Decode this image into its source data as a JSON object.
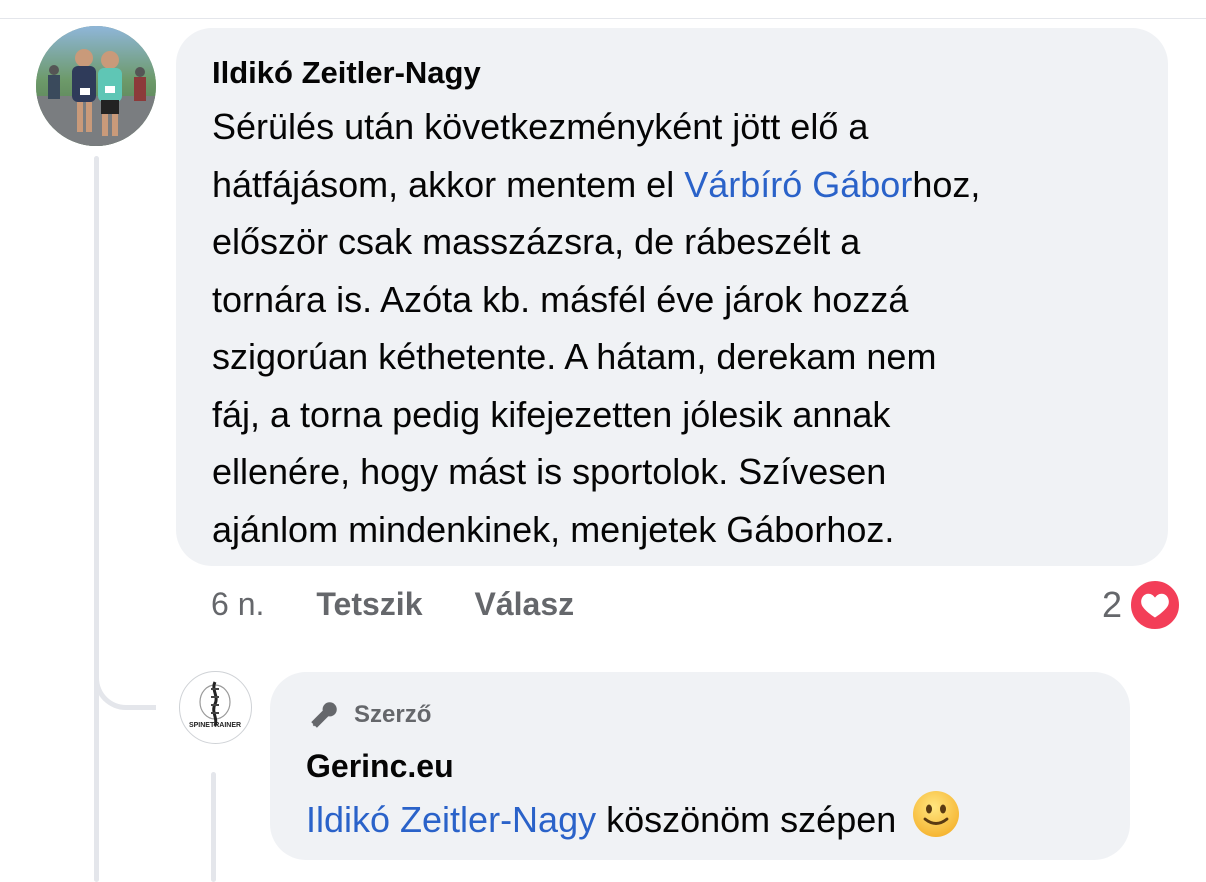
{
  "comment": {
    "author": "Ildikó Zeitler-Nagy",
    "lines": [
      {
        "before": "Sérülés után következményként jött elő a",
        "mention": "",
        "after": ""
      },
      {
        "before": "hátfájásom, akkor mentem el ",
        "mention": "Várbíró Gábor",
        "after": "hoz,"
      },
      {
        "before": "először csak masszázsra, de rábeszélt a",
        "mention": "",
        "after": ""
      },
      {
        "before": "tornára is. Azóta kb. másfél éve járok hozzá",
        "mention": "",
        "after": ""
      },
      {
        "before": "szigorúan kéthetente. A hátam, derekam nem",
        "mention": "",
        "after": ""
      },
      {
        "before": "fáj, a torna pedig kifejezetten jólesik annak",
        "mention": "",
        "after": ""
      },
      {
        "before": "ellenére, hogy mást is sportolok. Szívesen",
        "mention": "",
        "after": ""
      },
      {
        "before": "ajánlom mindenkinek, menjetek Gáborhoz.",
        "mention": "",
        "after": ""
      }
    ],
    "time": "6 n.",
    "like_label": "Tetszik",
    "reply_label": "Válasz",
    "reaction_count": "2",
    "reaction_icon": "heart-icon",
    "reaction_color": "#f33e58"
  },
  "reply": {
    "badge_label": "Szerző",
    "badge_icon": "microphone-icon",
    "author": "Gerinc.eu",
    "mention": "Ildikó Zeitler-Nagy",
    "text": " köszönöm szépen",
    "emoji": "slightly-smiling-face-emoji",
    "avatar_logo_text": "SPINETRAINER"
  },
  "colors": {
    "mention": "#2a62c9",
    "bubble": "#f0f2f5",
    "secondary_text": "#65676b"
  }
}
